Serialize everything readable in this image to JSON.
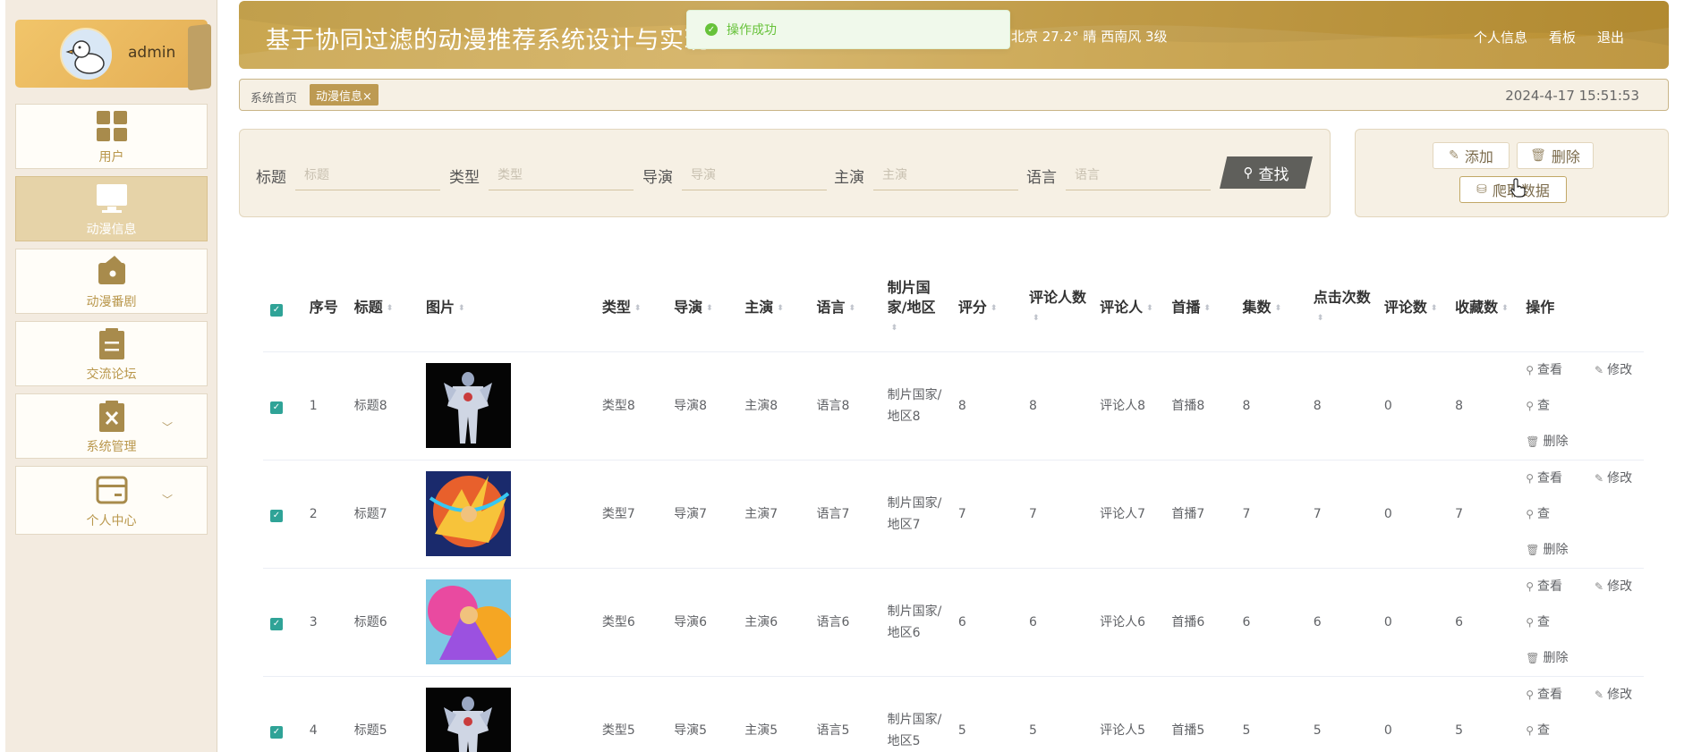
{
  "sidebar": {
    "username": "admin",
    "items": [
      {
        "label": "用户",
        "icon": "grid-icon",
        "active": false
      },
      {
        "label": "动漫信息",
        "icon": "monitor-icon",
        "active": true
      },
      {
        "label": "动漫番剧",
        "icon": "wallet-icon",
        "active": false
      },
      {
        "label": "交流论坛",
        "icon": "clipboard-icon",
        "active": false
      },
      {
        "label": "系统管理",
        "icon": "clipboard-x-icon",
        "active": false,
        "chevron": "﹀"
      },
      {
        "label": "个人中心",
        "icon": "card-icon",
        "active": false,
        "chevron": "﹀"
      }
    ]
  },
  "header": {
    "title": "基于协同过滤的动漫推荐系统设计与实现",
    "weather": "北京  27.2°  晴  西南风  3级",
    "nav": [
      "个人信息",
      "看板",
      "退出"
    ]
  },
  "toast": {
    "message": "操作成功"
  },
  "breadcrumb": {
    "home": "系统首页",
    "tag": "动漫信息",
    "close": "×",
    "datetime": "2024-4-17 15:51:53"
  },
  "search": {
    "fields": [
      {
        "label": "标题",
        "placeholder": "标题"
      },
      {
        "label": "类型",
        "placeholder": "类型"
      },
      {
        "label": "导演",
        "placeholder": "导演"
      },
      {
        "label": "主演",
        "placeholder": "主演"
      },
      {
        "label": "语言",
        "placeholder": "语言"
      }
    ],
    "button": "查找"
  },
  "actions": {
    "add": "添加",
    "delete": "删除",
    "crawl": "爬取数据"
  },
  "table": {
    "headers": [
      "序号",
      "标题",
      "图片",
      "类型",
      "导演",
      "主演",
      "语言",
      "制片国家/地区",
      "评分",
      "评论人数",
      "评论人",
      "首播",
      "集数",
      "点击次数",
      "评论数",
      "收藏数",
      "操作"
    ],
    "ops": {
      "view": "查看",
      "edit": "修改",
      "view2": "查",
      "delete": "删除"
    },
    "rows": [
      {
        "no": "1",
        "title": "标题8",
        "type": "类型8",
        "director": "导演8",
        "actor": "主演8",
        "language": "语言8",
        "country": "制片国家/地区8",
        "score": "8",
        "reviewers_count": "8",
        "reviewer": "评论人8",
        "premiere": "首播8",
        "episodes": "8",
        "clicks": "8",
        "comments": "0",
        "favorites": "8",
        "thumb": "armor-hero"
      },
      {
        "no": "2",
        "title": "标题7",
        "type": "类型7",
        "director": "导演7",
        "actor": "主演7",
        "language": "语言7",
        "country": "制片国家/地区7",
        "score": "7",
        "reviewers_count": "7",
        "reviewer": "评论人7",
        "premiere": "首播7",
        "episodes": "7",
        "clicks": "7",
        "comments": "0",
        "favorites": "7",
        "thumb": "fire-warrior"
      },
      {
        "no": "3",
        "title": "标题6",
        "type": "类型6",
        "director": "导演6",
        "actor": "主演6",
        "language": "语言6",
        "country": "制片国家/地区6",
        "score": "6",
        "reviewers_count": "6",
        "reviewer": "评论人6",
        "premiere": "首播6",
        "episodes": "6",
        "clicks": "6",
        "comments": "0",
        "favorites": "6",
        "thumb": "colorful-warrior"
      },
      {
        "no": "4",
        "title": "标题5",
        "type": "类型5",
        "director": "导演5",
        "actor": "主演5",
        "language": "语言5",
        "country": "制片国家/地区5",
        "score": "5",
        "reviewers_count": "5",
        "reviewer": "评论人5",
        "premiere": "首播5",
        "episodes": "5",
        "clicks": "5",
        "comments": "0",
        "favorites": "5",
        "thumb": "armor-hero"
      }
    ]
  },
  "colors": {
    "accent": "#c9a64f",
    "checkbox": "#2fa397",
    "active_menu": "#e6d3a8",
    "success": "#67c23a"
  }
}
